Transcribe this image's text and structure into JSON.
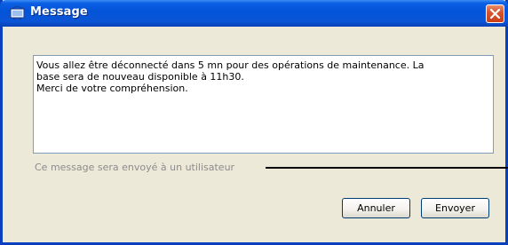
{
  "window": {
    "title": "Message",
    "title_icon": "message-board-icon",
    "close_icon": "close-icon"
  },
  "message": {
    "text": "Vous allez être déconnecté dans 5 mn pour des opérations de maintenance. La\nbase sera de nouveau disponible à 11h30.\nMerci de votre compréhension."
  },
  "recipient": {
    "label": "Ce message sera envoyé à un utilisateur"
  },
  "buttons": {
    "cancel_label": "Annuler",
    "send_label": "Envoyer"
  },
  "colors": {
    "titlebar": "#0454d8",
    "close_button": "#d8552c",
    "dialog_background": "#ece9d8",
    "border": "#0a3fbd"
  }
}
